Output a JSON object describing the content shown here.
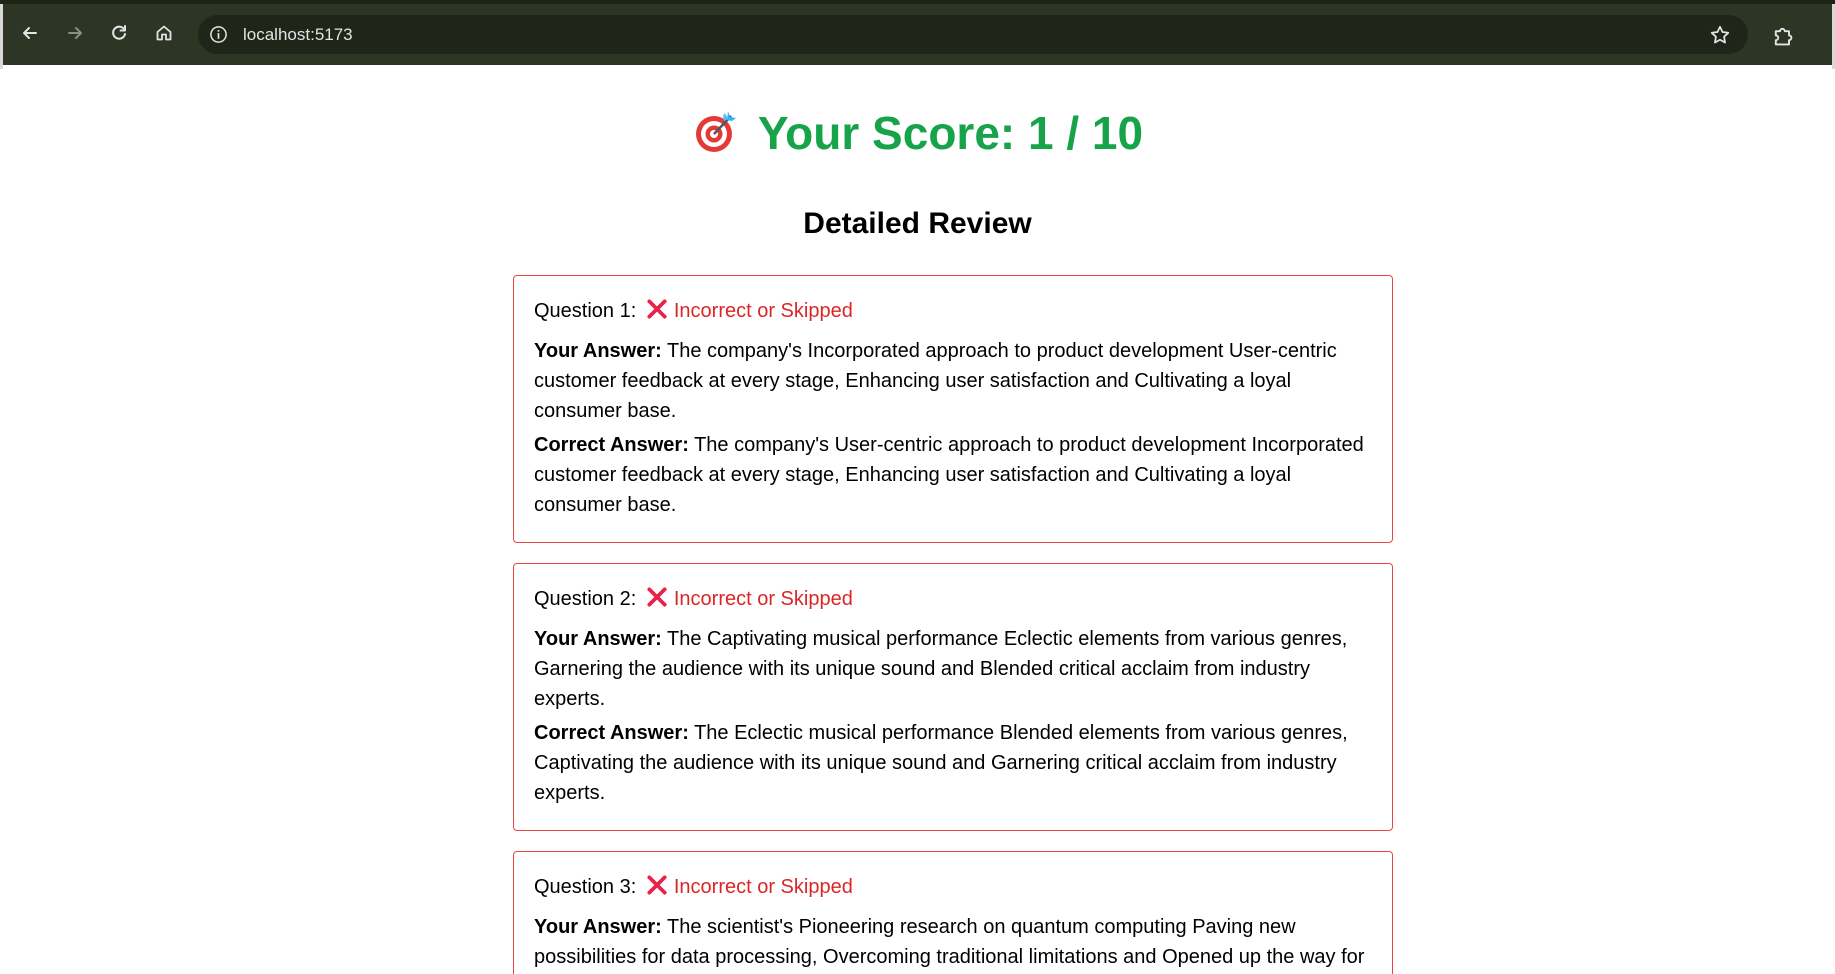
{
  "browser": {
    "url": "localhost:5173",
    "icons": {
      "back": "back-arrow-icon",
      "forward": "forward-arrow-icon",
      "reload": "reload-icon",
      "home": "home-icon",
      "site_info": "info-icon",
      "bookmark": "star-icon",
      "extensions": "puzzle-icon"
    }
  },
  "score": {
    "emoji_icon": "target-icon",
    "text": "Your Score: 1 / 10"
  },
  "review": {
    "title": "Detailed Review",
    "your_answer_label": "Your Answer:",
    "correct_answer_label": "Correct Answer:",
    "questions": [
      {
        "label": "Question 1:",
        "status": "Incorrect or Skipped",
        "your_answer": "The company's Incorporated approach to product development User-centric customer feedback at every stage, Enhancing user satisfaction and Cultivating a loyal consumer base.",
        "correct_answer": "The company's User-centric approach to product development Incorporated customer feedback at every stage, Enhancing user satisfaction and Cultivating a loyal consumer base."
      },
      {
        "label": "Question 2:",
        "status": "Incorrect or Skipped",
        "your_answer": "The Captivating musical performance Eclectic elements from various genres, Garnering the audience with its unique sound and Blended critical acclaim from industry experts.",
        "correct_answer": "The Eclectic musical performance Blended elements from various genres, Captivating the audience with its unique sound and Garnering critical acclaim from industry experts."
      },
      {
        "label": "Question 3:",
        "status": "Incorrect or Skipped",
        "your_answer": "The scientist's Pioneering research on quantum computing Paving new possibilities for data processing, Overcoming traditional limitations and Opened up the way for",
        "correct_answer": ""
      }
    ]
  },
  "colors": {
    "score_green": "#16a34a",
    "error_red": "#dc2626",
    "card_border": "#ef4444",
    "chrome_bg": "#2d3524"
  }
}
